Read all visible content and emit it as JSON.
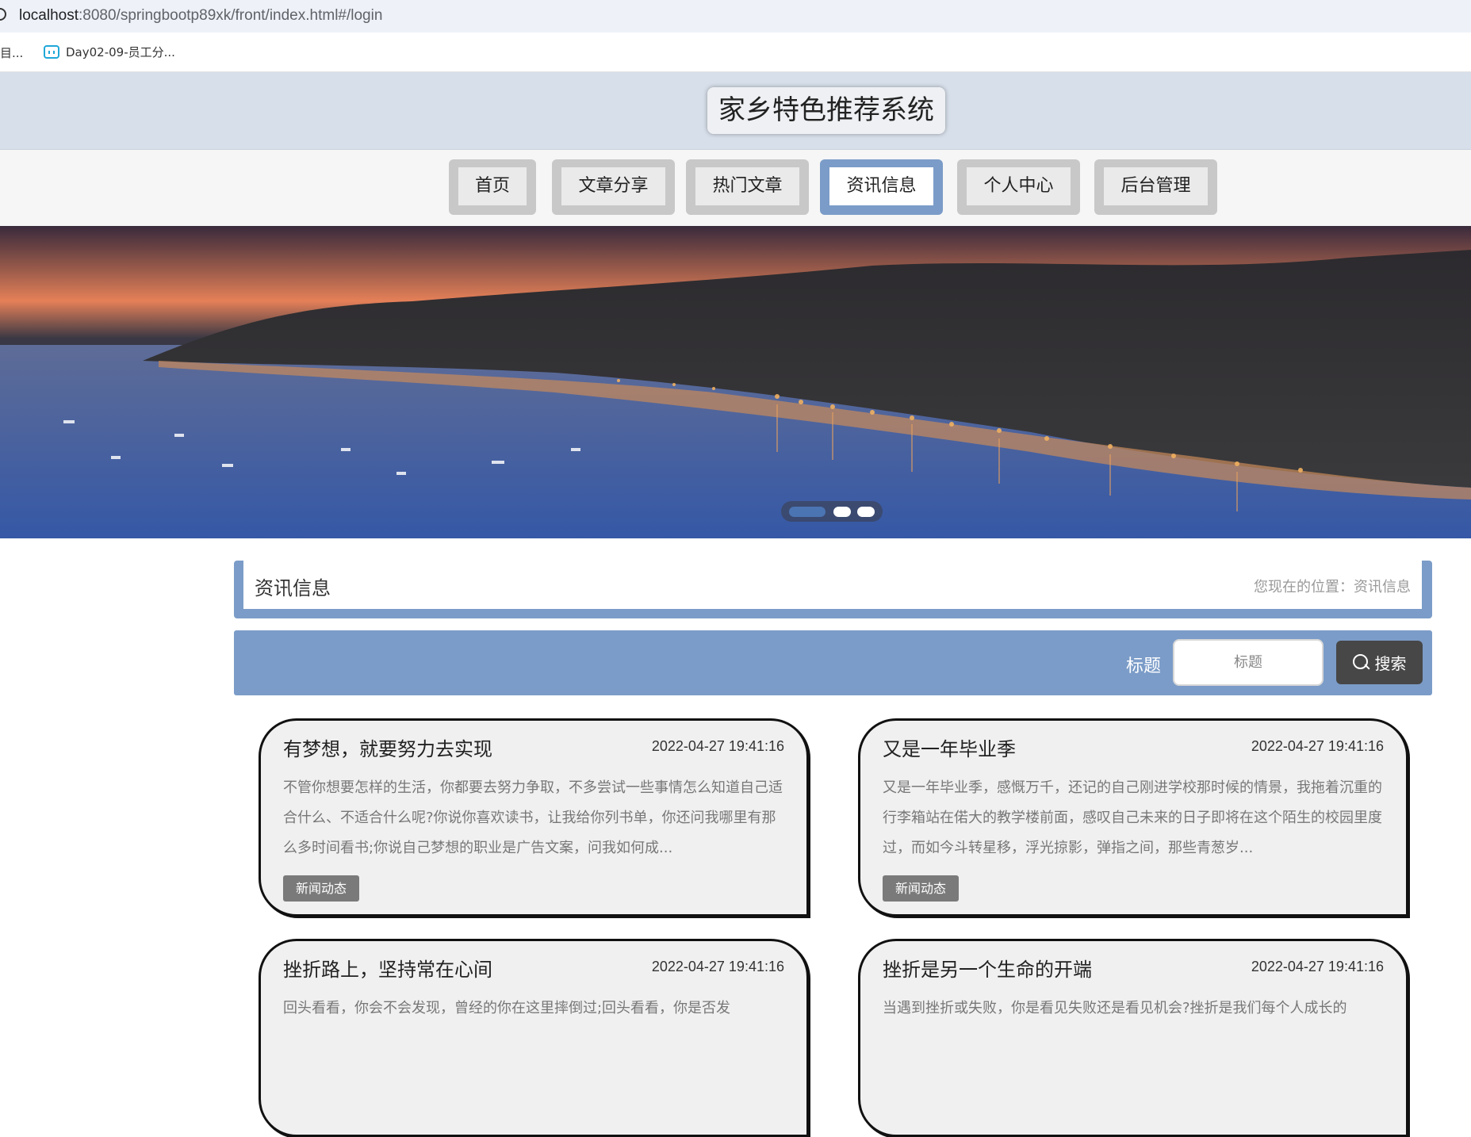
{
  "browser": {
    "url_host": "localhost",
    "url_path": ":8080/springbootp89xk/front/index.html#/login",
    "bookmark_truncated": "目...",
    "bookmark_label": "Day02-09-员工分..."
  },
  "header": {
    "title": "家乡特色推荐系统"
  },
  "nav": {
    "items": [
      {
        "label": "首页"
      },
      {
        "label": "文章分享"
      },
      {
        "label": "热门文章"
      },
      {
        "label": "资讯信息"
      },
      {
        "label": "个人中心"
      },
      {
        "label": "后台管理"
      }
    ],
    "active_index": 3
  },
  "carousel": {
    "slide_count": 3,
    "active_index": 0
  },
  "section": {
    "title": "资讯信息",
    "breadcrumb": "您现在的位置：资讯信息"
  },
  "search": {
    "label": "标题",
    "placeholder": "标题",
    "button_label": "搜索"
  },
  "news": [
    {
      "title": "有梦想，就要努力去实现",
      "time": "2022-04-27 19:41:16",
      "summary": "不管你想要怎样的生活，你都要去努力争取，不多尝试一些事情怎么知道自己适合什么、不适合什么呢?你说你喜欢读书，让我给你列书单，你还问我哪里有那么多时间看书;你说自己梦想的职业是广告文案，问我如何成...",
      "tag": "新闻动态"
    },
    {
      "title": "又是一年毕业季",
      "time": "2022-04-27 19:41:16",
      "summary": "又是一年毕业季，感慨万千，还记的自己刚进学校那时候的情景，我拖着沉重的行李箱站在偌大的教学楼前面，感叹自己未来的日子即将在这个陌生的校园里度过，而如今斗转星移，浮光掠影，弹指之间，那些青葱岁...",
      "tag": "新闻动态"
    },
    {
      "title": "挫折路上，坚持常在心间",
      "time": "2022-04-27 19:41:16",
      "summary": "回头看看，你会不会发现，曾经的你在这里摔倒过;回头看看，你是否发",
      "tag": ""
    },
    {
      "title": "挫折是另一个生命的开端",
      "time": "2022-04-27 19:41:16",
      "summary": "当遇到挫折或失败，你是看见失败还是看见机会?挫折是我们每个人成长的",
      "tag": ""
    }
  ],
  "colors": {
    "accent": "#7b9cc8",
    "header_bg": "#d7dfea",
    "search_button": "#474747",
    "tag_bg": "#7a7a7a"
  }
}
